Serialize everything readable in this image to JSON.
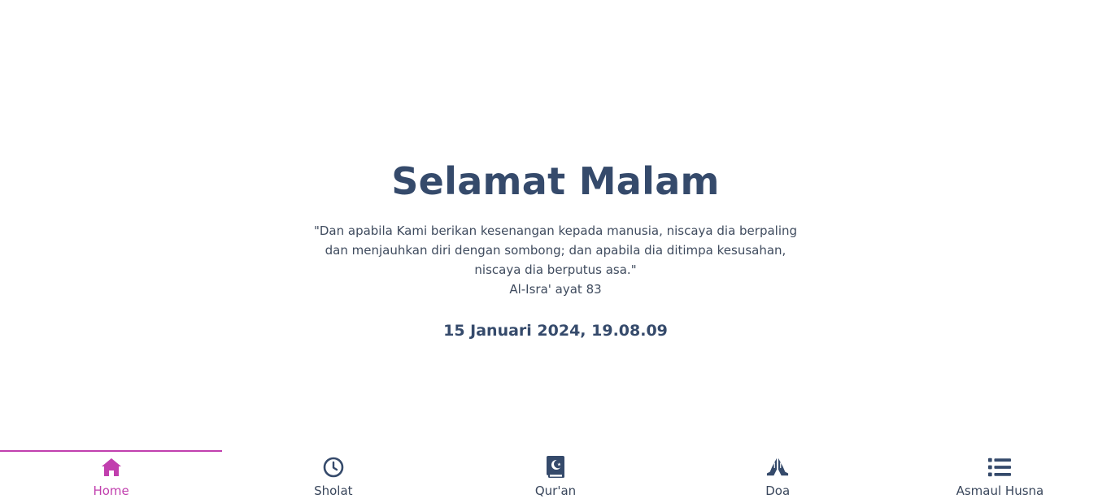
{
  "hero": {
    "greeting": "Selamat Malam",
    "quote_line1": "\"Dan apabila Kami berikan kesenangan kepada manusia, niscaya dia berpaling",
    "quote_line2": "dan menjauhkan diri dengan sombong; dan apabila dia ditimpa kesusahan,",
    "quote_line3": "niscaya dia berputus asa.\"",
    "quote_source": "Al-Isra' ayat 83",
    "datetime": "15 Januari 2024, 19.08.09"
  },
  "nav": {
    "items": [
      {
        "label": "Home",
        "icon": "home-icon",
        "active": true
      },
      {
        "label": "Sholat",
        "icon": "clock-icon",
        "active": false
      },
      {
        "label": "Qur'an",
        "icon": "quran-icon",
        "active": false
      },
      {
        "label": "Doa",
        "icon": "praying-hands-icon",
        "active": false
      },
      {
        "label": "Asmaul Husna",
        "icon": "list-icon",
        "active": false
      }
    ]
  },
  "colors": {
    "accent": "#c13fae",
    "text_dark": "#354a6b",
    "background": "#ffffff"
  }
}
